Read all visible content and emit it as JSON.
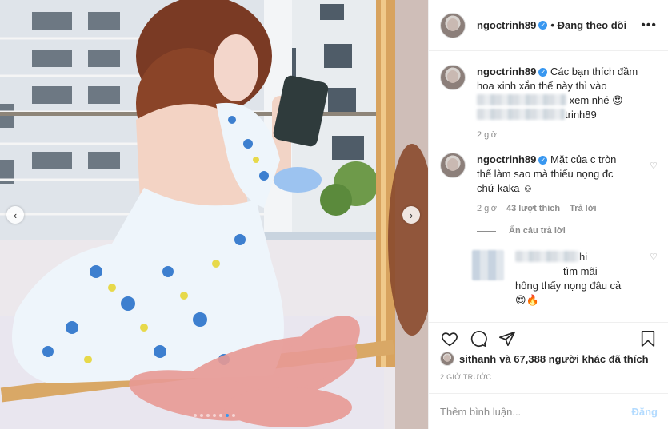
{
  "post": {
    "author": "ngoctrinh89",
    "follow_status": "• Đang theo dõi",
    "more_icon": "more-horizontal-icon",
    "verified_icon": "verified-badge-icon"
  },
  "photo": {
    "prev_arrow": "‹",
    "next_arrow": "›",
    "dots_count": 7,
    "active_dot": 5
  },
  "comments": [
    {
      "username": "ngoctrinh89",
      "text_before": "Các bạn thích đầm hoa xinh xắn thế này thì vào",
      "text_after": "xem nhé 😍",
      "mention_tail": "trinh89",
      "time": "2 giờ"
    },
    {
      "username": "ngoctrinh89",
      "text": "Mặt của c tròn thế làm sao mà thiếu nọng đc chứ kaka ☺",
      "time": "2 giờ",
      "likes": "43 lượt thích",
      "reply_label": "Trả lời",
      "hide_replies": "Ẩn câu trả lời"
    }
  ],
  "reply": {
    "line1_tail": "hi",
    "line2_tail": "tìm mãi",
    "line3": "hông thấy nọng đâu cả",
    "line4": "😍🔥"
  },
  "actions": {
    "like_icon": "heart-icon",
    "comment_icon": "comment-icon",
    "share_icon": "share-icon",
    "save_icon": "bookmark-icon"
  },
  "likes": {
    "first_user": "sithanh",
    "text": "và 67,388 người khác đã thích"
  },
  "timestamp": "2 GIỜ TRƯỚC",
  "add_comment": {
    "placeholder": "Thêm bình luận...",
    "post_label": "Đăng"
  },
  "colors": {
    "accent": "#3897f0",
    "post_disabled": "#b3dbff",
    "meta": "#8e8e8e"
  }
}
